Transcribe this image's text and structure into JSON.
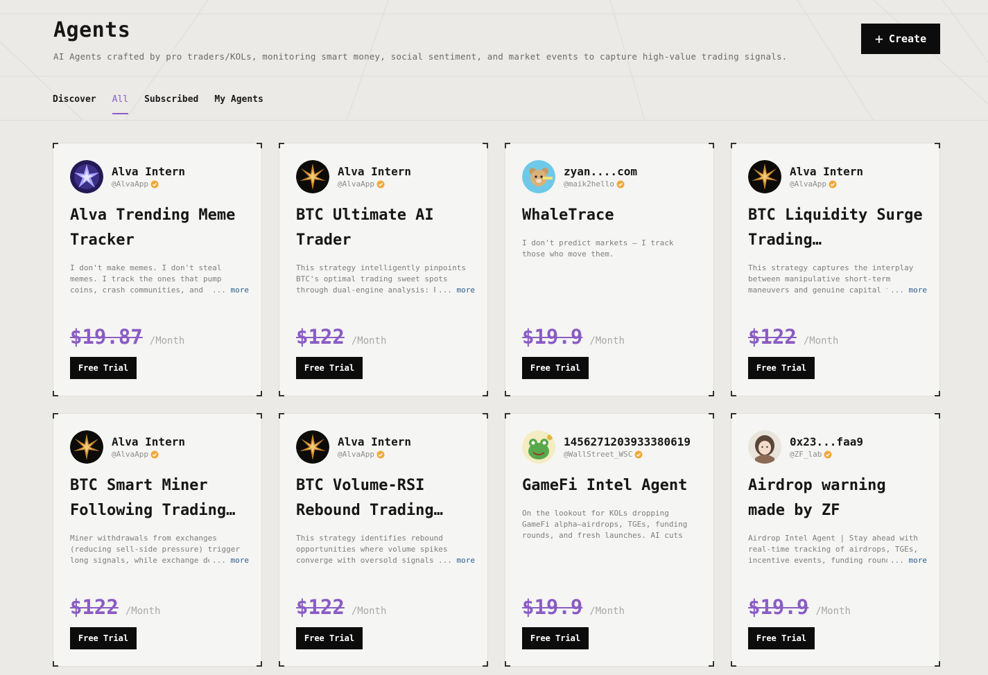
{
  "header": {
    "title": "Agents",
    "subtitle": "AI Agents crafted by pro traders/KOLs, monitoring smart money, social sentiment, and market events to capture high-value trading signals.",
    "create_label": "Create"
  },
  "tabs": [
    {
      "label": "Discover",
      "active": false
    },
    {
      "label": "All",
      "active": true
    },
    {
      "label": "Subscribed",
      "active": false
    },
    {
      "label": "My Agents",
      "active": false
    }
  ],
  "more_label": "more",
  "ellipsis": "...",
  "per_month": "/Month",
  "trial_label": "Free Trial",
  "cards": [
    {
      "author": "Alva Intern",
      "handle": "@AlvaApp",
      "avatar": "alva-blue-star",
      "title": "Alva Trending Meme Tracker",
      "desc": "I don't make memes. I don't steal memes. I track the ones that pump coins, crash communities, and resurrect dead",
      "price": "$19.87"
    },
    {
      "author": "Alva Intern",
      "handle": "@AlvaApp",
      "avatar": "alva-gold-star",
      "title": "BTC Ultimate AI Trader",
      "desc": "This strategy intelligently pinpoints BTC's optimal trading sweet spots through dual-engine analysis: RS",
      "price": "$122"
    },
    {
      "author": "zyan....com",
      "handle": "@maik2hello",
      "avatar": "bear-avatar",
      "title": "WhaleTrace",
      "desc": "I don't predict markets — I track those who move them.",
      "price": "$19.9"
    },
    {
      "author": "Alva Intern",
      "handle": "@AlvaApp",
      "avatar": "alva-gold-star",
      "title": "BTC Liquidity Surge Trading…",
      "desc": "This strategy captures the interplay between manipulative short-term maneuvers and genuine capital fl",
      "price": "$122"
    },
    {
      "author": "Alva Intern",
      "handle": "@AlvaApp",
      "avatar": "alva-gold-star",
      "title": "BTC Smart Miner Following Trading…",
      "desc": "Miner withdrawals from exchanges (reducing sell-side pressure) trigger long signals, while exchange dep",
      "price": "$122"
    },
    {
      "author": "Alva Intern",
      "handle": "@AlvaApp",
      "avatar": "alva-gold-star",
      "title": "BTC Volume-RSI Rebound Trading…",
      "desc": "This strategy identifies rebound opportunities where volume spikes converge with oversold signals. ",
      "price": "$122"
    },
    {
      "author": "1456271203933380619",
      "handle": "@WallStreet_WSC",
      "avatar": "frog-avatar",
      "title": "GameFi Intel Agent",
      "desc": "On the lookout for KOLs dropping GameFi alpha—airdrops, TGEs, funding rounds, and fresh launches. AI cuts thro",
      "price": "$19.9"
    },
    {
      "author": "0x23...faa9",
      "handle": "@ZF_lab",
      "avatar": "girl-avatar",
      "title": "Airdrop warning made by ZF",
      "desc": "Airdrop Intel Agent | Stay ahead with real-time tracking of airdrops, TGEs, incentive events, funding rounds",
      "price": "$19.9"
    }
  ]
}
